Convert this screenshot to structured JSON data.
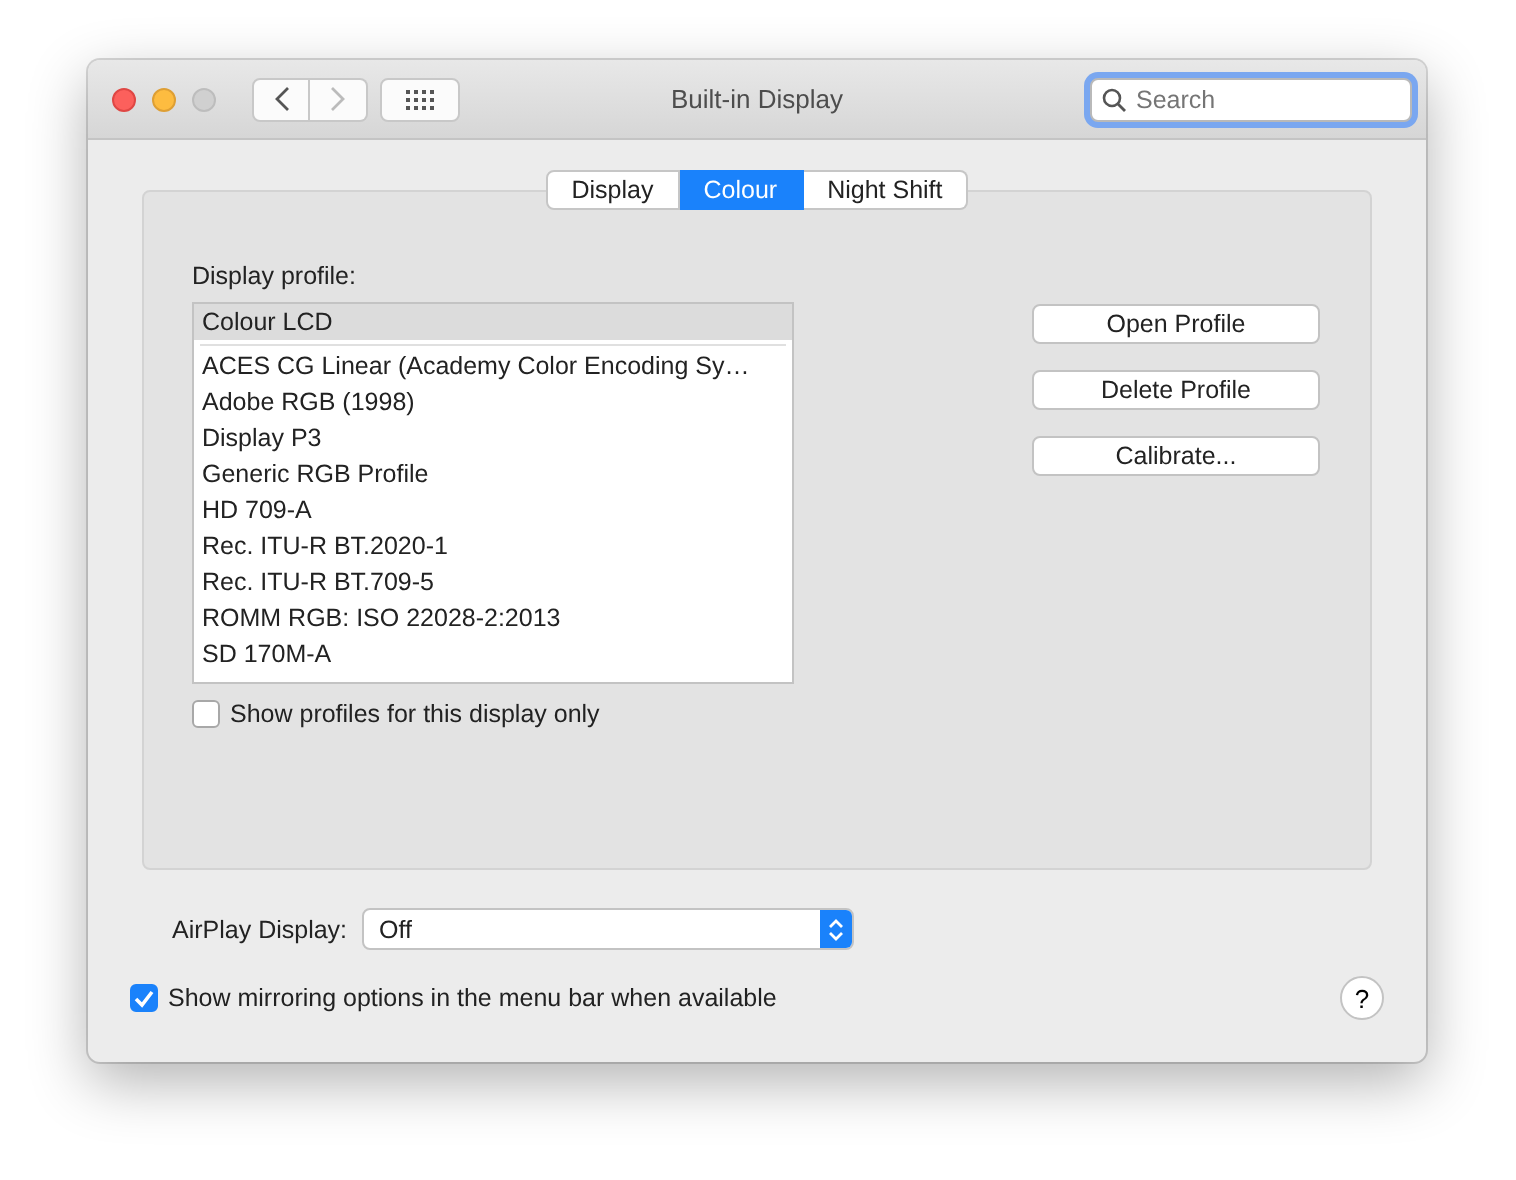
{
  "window": {
    "title": "Built-in Display"
  },
  "toolbar": {
    "back_enabled": true,
    "forward_enabled": false,
    "search": {
      "placeholder": "Search",
      "focused": true
    }
  },
  "tabs": [
    {
      "label": "Display",
      "selected": false
    },
    {
      "label": "Colour",
      "selected": true
    },
    {
      "label": "Night Shift",
      "selected": false
    }
  ],
  "profile_label": "Display profile:",
  "profile_sections": [
    [
      {
        "label": "Colour LCD",
        "selected": true
      }
    ],
    [
      {
        "label": "ACES CG Linear (Academy Color Encoding Sy…",
        "selected": false
      },
      {
        "label": "Adobe RGB (1998)",
        "selected": false
      },
      {
        "label": "Display P3",
        "selected": false
      },
      {
        "label": "Generic RGB Profile",
        "selected": false
      },
      {
        "label": "HD 709-A",
        "selected": false
      },
      {
        "label": "Rec. ITU-R BT.2020-1",
        "selected": false
      },
      {
        "label": "Rec. ITU-R BT.709-5",
        "selected": false
      },
      {
        "label": "ROMM RGB: ISO 22028-2:2013",
        "selected": false
      },
      {
        "label": "SD 170M-A",
        "selected": false
      }
    ]
  ],
  "profile_buttons": [
    "Open Profile",
    "Delete Profile",
    "Calibrate..."
  ],
  "this_display_only": {
    "label": "Show profiles for this display only",
    "checked": false
  },
  "airplay": {
    "label": "AirPlay Display:",
    "value": "Off"
  },
  "mirroring": {
    "label": "Show mirroring options in the menu bar when available",
    "checked": true
  },
  "help": "?"
}
